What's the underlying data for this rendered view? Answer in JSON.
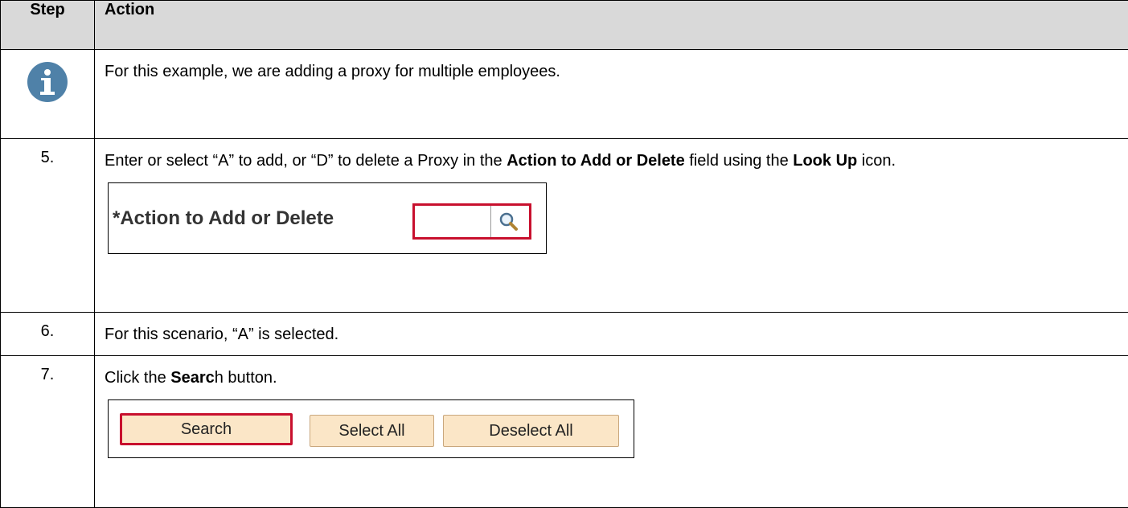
{
  "table": {
    "headers": {
      "step": "Step",
      "action": "Action"
    }
  },
  "rows": {
    "info": {
      "text": "For this example, we are adding a proxy for multiple employees."
    },
    "step5": {
      "num": "5.",
      "t1": "Enter or select “A” to add, or “D” to delete a Proxy in the ",
      "b1": "Action to Add or Delete",
      "t2": " field using the ",
      "b2": "Look Up",
      "t3": " icon.",
      "screenshot": {
        "label": "*Action to Add or Delete",
        "field_value": ""
      }
    },
    "step6": {
      "num": "6.",
      "text": "For this scenario, “A” is selected."
    },
    "step7": {
      "num": "7.",
      "t1": "Click the ",
      "b1": "Searc",
      "t2": "h button.",
      "buttons": {
        "search": "Search",
        "select_all": "Select All",
        "deselect_all": "Deselect All"
      }
    }
  },
  "icons": {
    "info": "info-icon",
    "lookup": "magnifier-icon"
  },
  "colors": {
    "header_bg": "#d9d9d9",
    "highlight": "#c8102e",
    "info_icon": "#4f81a8",
    "button_bg": "#fbe6c7"
  }
}
